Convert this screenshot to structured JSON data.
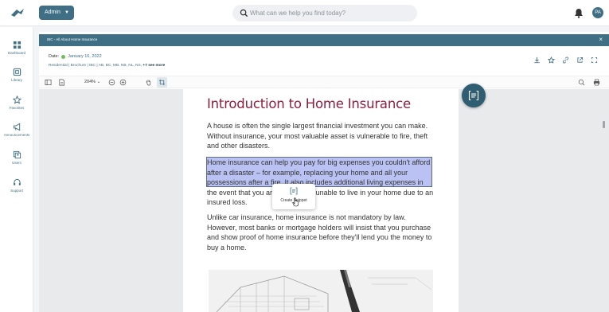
{
  "header": {
    "role_button": "Admin",
    "search_placeholder": "What can we help you find today?",
    "avatar_initials": "PA"
  },
  "sidebar": {
    "items": [
      {
        "label": "Dashboard",
        "icon": "dashboard-icon"
      },
      {
        "label": "Library",
        "icon": "library-icon"
      },
      {
        "label": "Favorites",
        "icon": "star-icon"
      },
      {
        "label": "Announcements",
        "icon": "megaphone-icon"
      },
      {
        "label": "Users",
        "icon": "users-icon"
      },
      {
        "label": "Support",
        "icon": "headset-icon"
      }
    ]
  },
  "document": {
    "tab_title": "IBC - All About Home Insurance",
    "date_label": "Date:",
    "date_value": "January 16, 2022",
    "tags": "Residential | Brochure | IBC | AB, BC, MB, NB, NL, NS,",
    "tags_more": "+7 see more"
  },
  "toolbar": {
    "zoom": "204%"
  },
  "page": {
    "heading": "Introduction to Home Insurance",
    "p1": "A house is often the single largest financial investment you can make. Without insurance, your most valuable asset is vulnerable to fire, theft and other disasters.",
    "p2": "Home insurance can help you pay for big expenses you couldn't afford after a disaster – for example, replacing your home and all your possessions after a fire. It also includes additional living expenses in the event that you are temporarily unable to live in your home due to an insured loss.",
    "p3": "Unlike car insurance, home insurance is not mandatory by law. However, most banks or mortgage holders will insist that you purchase and show proof of home insurance before they'll lend you the money to buy a home."
  },
  "popup": {
    "label": "Create Snippet"
  },
  "colors": {
    "brand": "#3e6f85",
    "heading": "#8e1f3f",
    "highlight": "#b9c2f2"
  }
}
